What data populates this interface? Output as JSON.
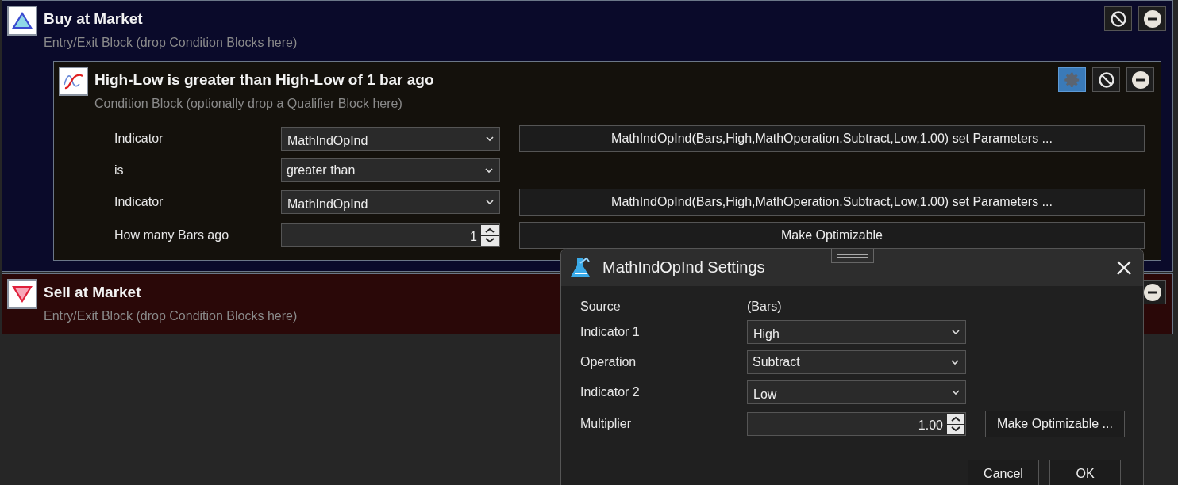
{
  "buy_block": {
    "kind": "buy",
    "title": "Buy at Market",
    "subtitle": "Entry/Exit Block (drop Condition Blocks here)",
    "buttons": [
      {
        "kind": "disable",
        "active": false
      },
      {
        "kind": "remove",
        "active": false
      }
    ],
    "condition": {
      "title": "High-Low is greater than High-Low of 1 bar ago",
      "subtitle": "Condition Block (optionally drop a Qualifier Block here)",
      "buttons": [
        {
          "kind": "settings",
          "active": true
        },
        {
          "kind": "disable",
          "active": false
        },
        {
          "kind": "remove",
          "active": false
        }
      ],
      "rows": [
        {
          "label": "Indicator",
          "kind": "combo",
          "value": "MathIndOpInd",
          "action": "MathIndOpInd(Bars,High,MathOperation.Subtract,Low,1.00) set Parameters ..."
        },
        {
          "label": "is",
          "kind": "select",
          "value": "greater than"
        },
        {
          "label": "Indicator",
          "kind": "combo",
          "value": "MathIndOpInd",
          "action": "MathIndOpInd(Bars,High,MathOperation.Subtract,Low,1.00) set Parameters ..."
        },
        {
          "label": "How many Bars ago",
          "kind": "spinner",
          "value": "1",
          "action": "Make Optimizable"
        }
      ]
    }
  },
  "sell_block": {
    "kind": "sell",
    "title": "Sell at Market",
    "subtitle": "Entry/Exit Block (drop Condition Blocks here)",
    "buttons": [
      {
        "kind": "remove",
        "active": false
      }
    ]
  },
  "dialog": {
    "title": "MathIndOpInd Settings",
    "rows": [
      {
        "label": "Source",
        "kind": "text",
        "value": "(Bars)"
      },
      {
        "label": "Indicator 1",
        "kind": "combo",
        "value": "High"
      },
      {
        "label": "Operation",
        "kind": "select",
        "value": "Subtract"
      },
      {
        "label": "Indicator 2",
        "kind": "combo",
        "value": "Low"
      },
      {
        "label": "Multiplier",
        "kind": "spinner",
        "value": "1.00",
        "action": "Make Optimizable ..."
      }
    ],
    "buttons": [
      "Cancel",
      "OK"
    ]
  }
}
